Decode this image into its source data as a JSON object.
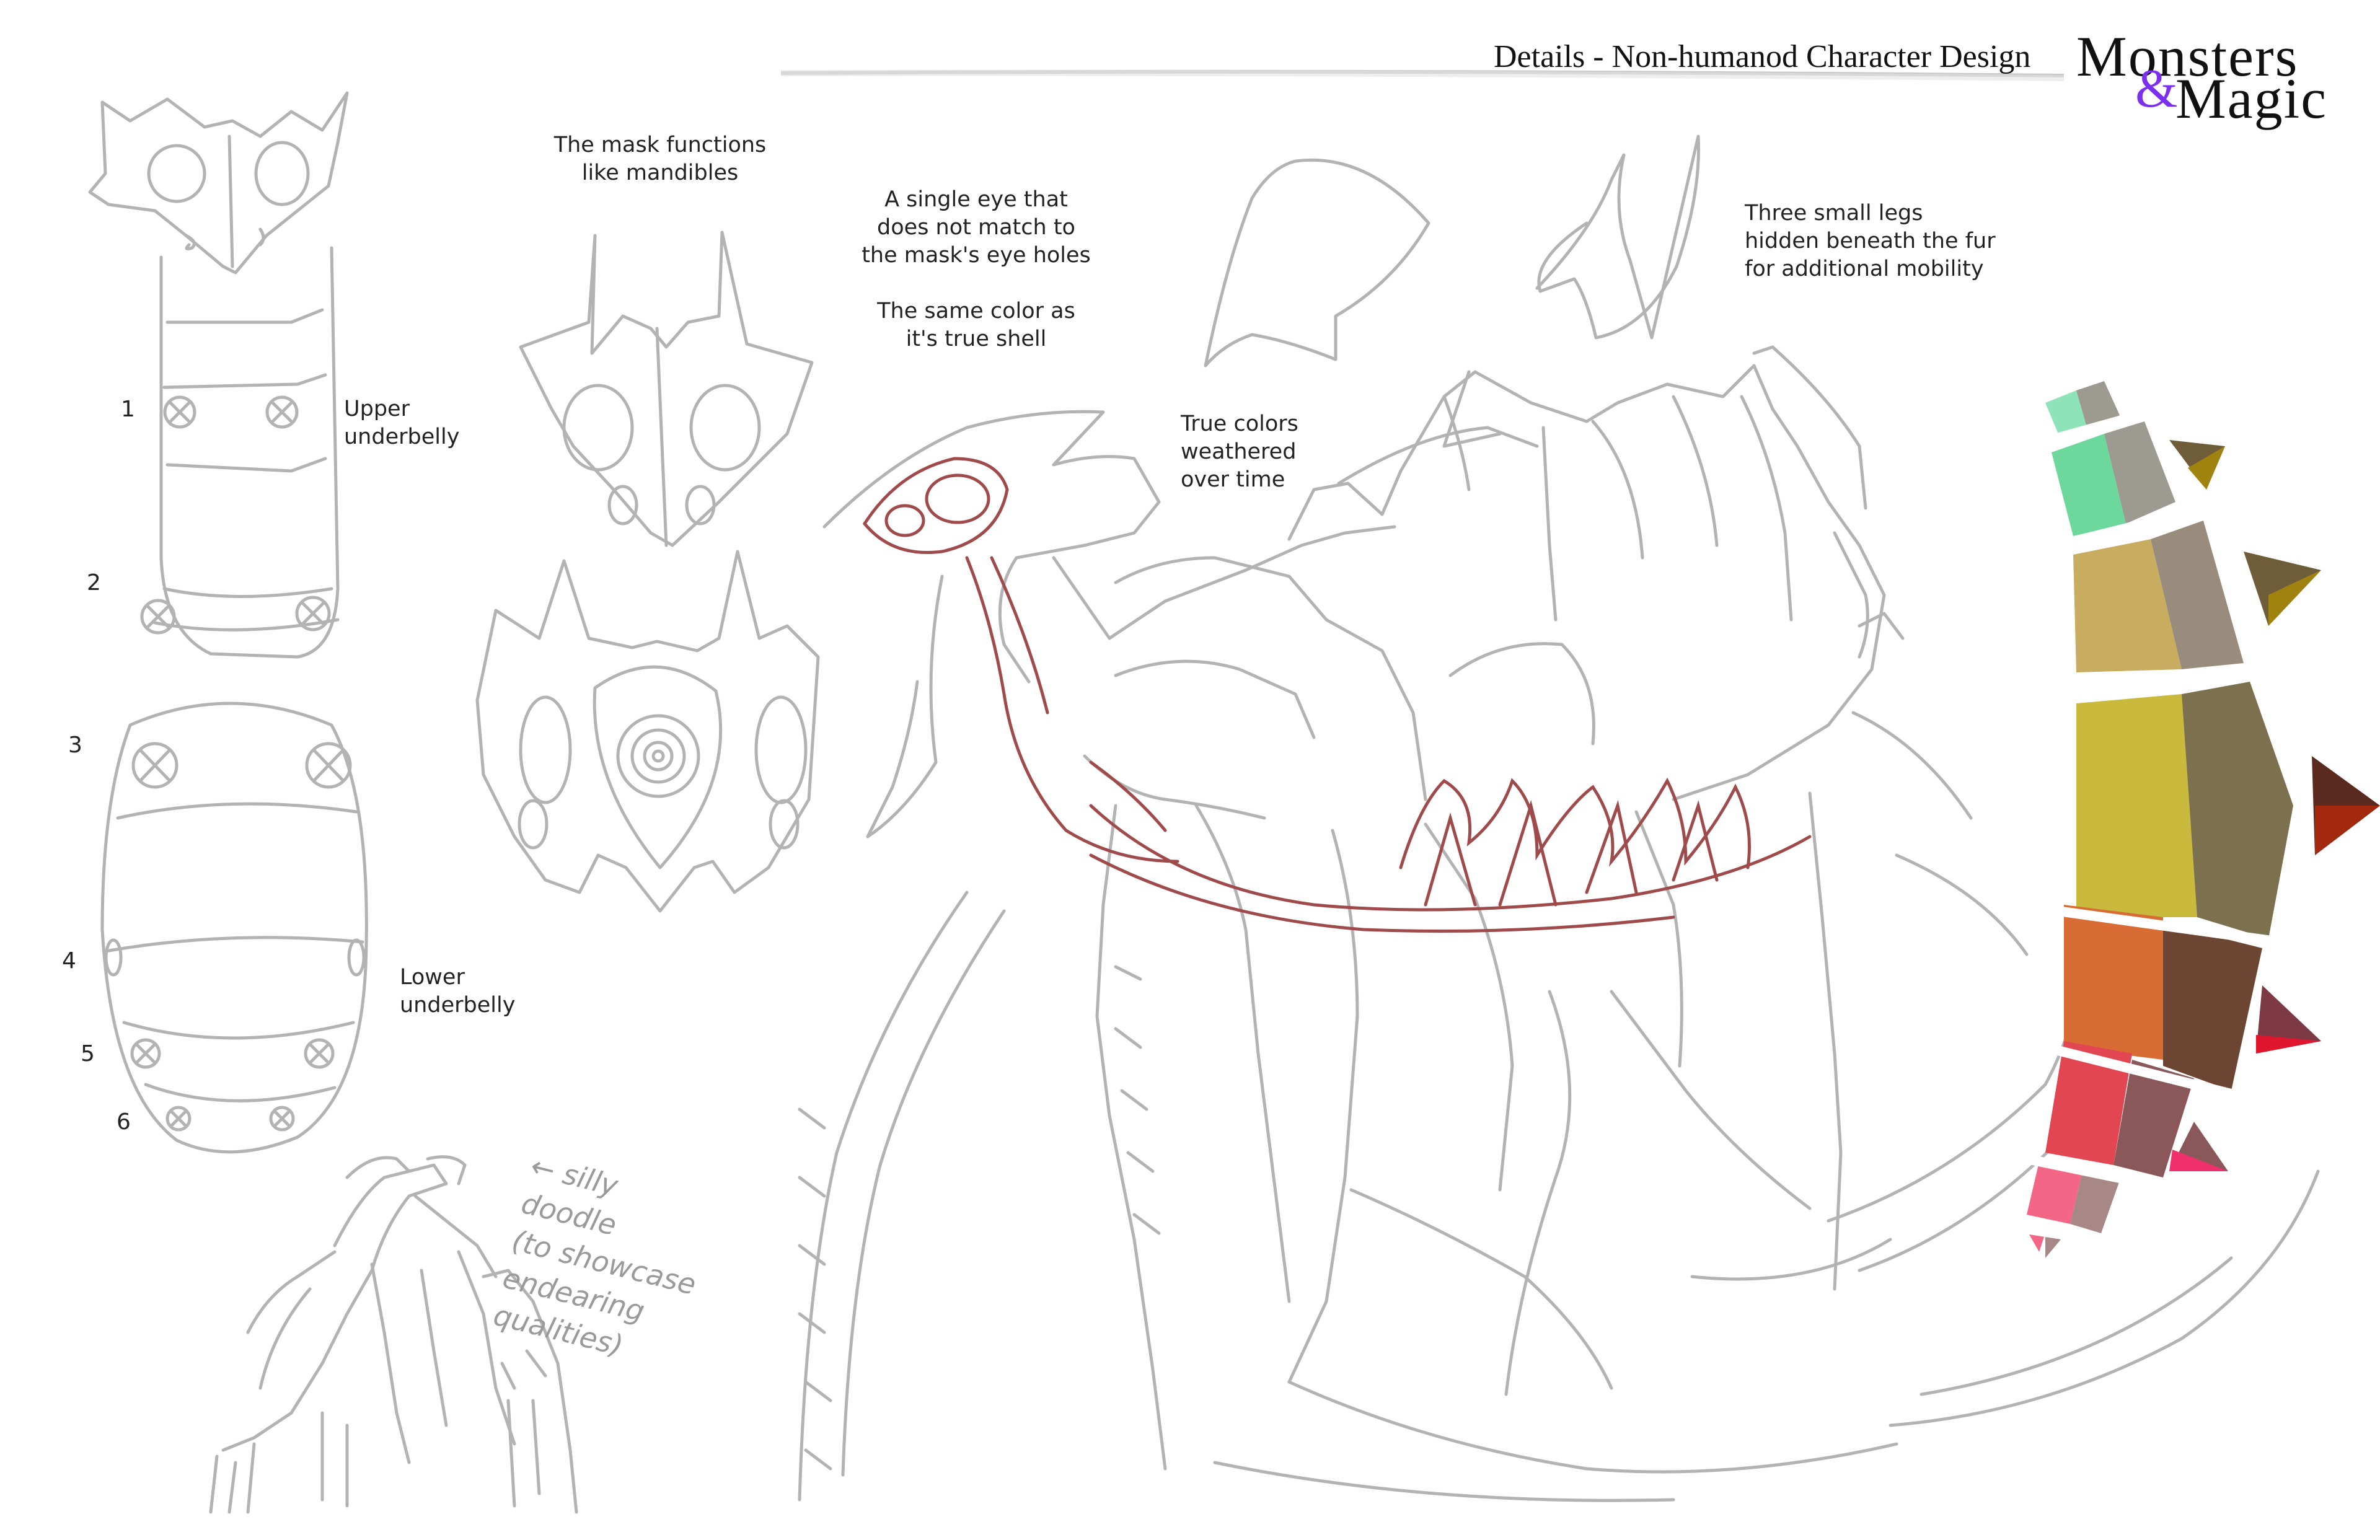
{
  "header": {
    "title": "Details - Non-humanod Character Design",
    "logo_line1": "Monsters",
    "logo_amp": "&",
    "logo_line2": "Magic",
    "accent_color": "#7b2ff0"
  },
  "notes": {
    "mask_mandibles": "The mask functions\nlike mandibles",
    "single_eye": "A single eye that\ndoes not match to\nthe mask's eye holes\n\nThe same color as\nit's true shell",
    "true_colors": "True colors\nweathered\nover time",
    "three_legs": "Three small legs\nhidden beneath the fur\nfor additional mobility",
    "upper_underbelly": "Upper\nunderbelly",
    "lower_underbelly": "Lower\nunderbelly",
    "silly_doodle": "← silly\ndoodle\n(to showcase\nendearing\nqualities)"
  },
  "segment_numbers": [
    "1",
    "2",
    "3",
    "4",
    "5",
    "6"
  ],
  "palette": {
    "colors": [
      "#8fe3b9",
      "#9d9a92",
      "#6dd89c",
      "#c8ad60",
      "#9a8c7c",
      "#c9b93c",
      "#7c704e",
      "#d96c35",
      "#6d4533",
      "#e24652",
      "#8a5858",
      "#f36686",
      "#a88787",
      "#6f5d3a",
      "#a0830f",
      "#5b2a1e",
      "#a3290e",
      "#7d3a44",
      "#e0162e",
      "#f0306d"
    ],
    "sketch_gray": "#b3b3b3",
    "sketch_red": "#a04b4b"
  }
}
